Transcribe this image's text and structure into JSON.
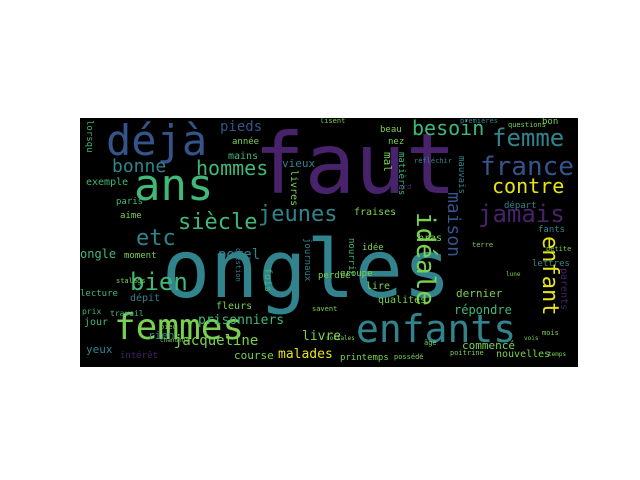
{
  "palette": {
    "teal": "#31848d",
    "green": "#3fb87a",
    "lime": "#7ad151",
    "yellow": "#e6e419",
    "purple": "#48226a",
    "navy": "#34548b",
    "background": "#000000"
  },
  "words": {
    "faut": "faut",
    "ongles": "ongles",
    "deja": "déjà",
    "ans": "ans",
    "femmes": "femmes",
    "enfants": "enfants",
    "jeunes": "jeunes",
    "siecle": "siècle",
    "bien": "bien",
    "etc": "etc",
    "bonne": "bonne",
    "hommes": "hommes",
    "jamais": "jamais",
    "besoin": "besoin",
    "femme": "femme",
    "france": "france",
    "contre": "contre",
    "ideale": "idéale",
    "enfant": "enfant",
    "maison": "maison",
    "pieds": "pieds",
    "porel": "porel",
    "prisonniers": "prisonniers",
    "jacqueline": "jacqueline",
    "malades": "malades",
    "livre": "livre",
    "repondre": "répondre",
    "dernier": "dernier",
    "commence": "commencé",
    "nouvelles": "nouvelles",
    "printemps": "printemps",
    "course": "course",
    "yeux": "yeux",
    "interet": "intérêt",
    "rien": "rien",
    "depit": "dépit",
    "ongle": "ongle",
    "exemple": "exemple",
    "moment": "moment",
    "lecture": "lecture",
    "jour": "jour",
    "paris": "paris",
    "aime": "aime",
    "vieux": "vieux",
    "fleurs": "fleurs",
    "mains": "mains",
    "annee": "année",
    "livres": "livres",
    "journaux": "journaux",
    "fois": "fois",
    "fraises": "fraises",
    "idee": "idée",
    "groupe": "groupe",
    "bras": "bras",
    "lire": "lire",
    "qualites": "qualités",
    "nourrir": "nourrir",
    "perdre": "perdre",
    "beau": "beau",
    "nez": "nez",
    "mal": "mal",
    "matieres": "matières",
    "mauvais": "mauvais",
    "depart": "départ",
    "fants": "fants",
    "lettres": "lettres",
    "parents": "parents",
    "lorsqu": "lorsqu",
    "bon": "bon",
    "questions": "questions",
    "premieres": "premières",
    "travail": "travail",
    "stalags": "stalags",
    "prix": "prix",
    "savent": "savent",
    "poitrine": "poitrine",
    "possede": "possédé",
    "terre": "terre",
    "mois": "mois",
    "temps": "temps",
    "lisent": "lisent",
    "accord": "accord",
    "petite": "petite",
    "age": "âge",
    "pied": "pied",
    "question": "question",
    "reflechir": "réfléchir",
    "sociales": "sociales",
    "vois": "vois",
    "lune": "lune",
    "chandhui": "chandhui"
  }
}
